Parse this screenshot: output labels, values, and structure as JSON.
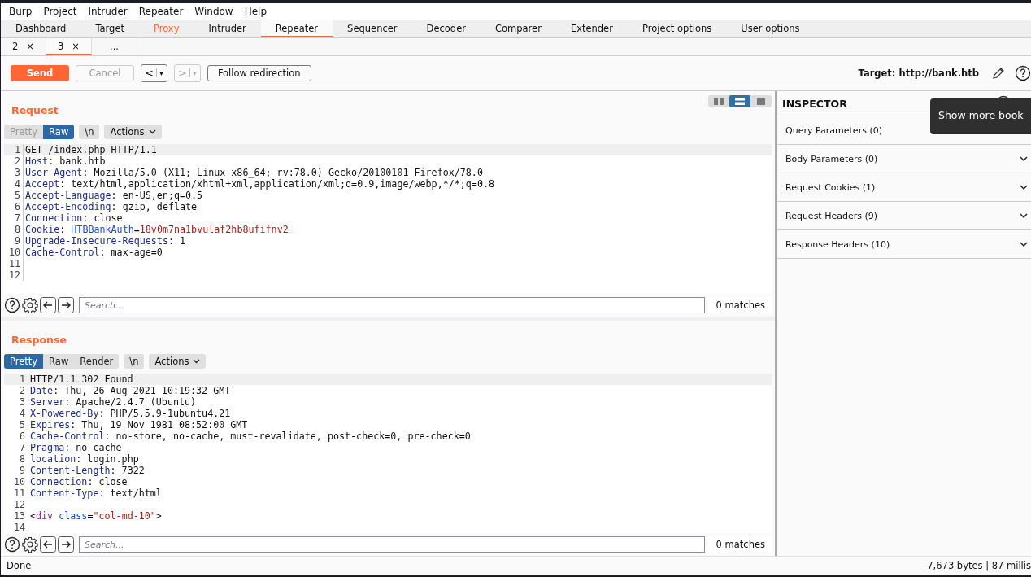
{
  "menu": [
    "Burp",
    "Project",
    "Intruder",
    "Repeater",
    "Window",
    "Help"
  ],
  "tabs": [
    {
      "label": "Dashboard",
      "selected": false,
      "highlighted": false
    },
    {
      "label": "Target",
      "selected": false,
      "highlighted": false
    },
    {
      "label": "Proxy",
      "selected": false,
      "highlighted": true
    },
    {
      "label": "Intruder",
      "selected": false,
      "highlighted": false
    },
    {
      "label": "Repeater",
      "selected": true,
      "highlighted": false
    },
    {
      "label": "Sequencer",
      "selected": false,
      "highlighted": false
    },
    {
      "label": "Decoder",
      "selected": false,
      "highlighted": false
    },
    {
      "label": "Comparer",
      "selected": false,
      "highlighted": false
    },
    {
      "label": "Extender",
      "selected": false,
      "highlighted": false
    },
    {
      "label": "Project options",
      "selected": false,
      "highlighted": false
    },
    {
      "label": "User options",
      "selected": false,
      "highlighted": false
    }
  ],
  "subtabs": [
    {
      "label": "2",
      "close": "×",
      "selected": false
    },
    {
      "label": "3",
      "close": "×",
      "selected": true
    },
    {
      "label": "...",
      "selected": false
    }
  ],
  "toolbar": {
    "send": "Send",
    "cancel": "Cancel",
    "cancel_disabled": true,
    "back": {
      "arrow": "<",
      "caret": "▾",
      "disabled": false
    },
    "forward": {
      "arrow": ">",
      "caret": "▾",
      "disabled": true
    },
    "follow": "Follow redirection",
    "target": "Target: http://bank.htb"
  },
  "layout_buttons": [
    {
      "kind": "columns",
      "selected": false
    },
    {
      "kind": "rows",
      "selected": true
    },
    {
      "kind": "single",
      "selected": false
    }
  ],
  "request": {
    "title": "Request",
    "views": [
      {
        "label": "Pretty",
        "selected": false,
        "disabled": true
      },
      {
        "label": "Raw",
        "selected": true,
        "disabled": false
      }
    ],
    "newline": "\\n",
    "actions": "Actions",
    "lines": [
      {
        "number": "1",
        "current": true,
        "segments": [
          {
            "kind": "plain",
            "text": "GET /index.php HTTP/1.1"
          }
        ]
      },
      {
        "number": "2",
        "current": false,
        "segments": [
          {
            "kind": "key",
            "text": "Host"
          },
          {
            "kind": "plain",
            "text": ": bank.htb"
          }
        ]
      },
      {
        "number": "3",
        "current": false,
        "segments": [
          {
            "kind": "key",
            "text": "User-Agent"
          },
          {
            "kind": "plain",
            "text": ": Mozilla/5.0 (X11; Linux x86_64; rv:78.0) Gecko/20100101 Firefox/78.0"
          }
        ]
      },
      {
        "number": "4",
        "current": false,
        "segments": [
          {
            "kind": "key",
            "text": "Accept"
          },
          {
            "kind": "plain",
            "text": ": text/html,application/xhtml+xml,application/xml;q=0.9,image/webp,*/*;q=0.8"
          }
        ]
      },
      {
        "number": "5",
        "current": false,
        "segments": [
          {
            "kind": "key",
            "text": "Accept-Language"
          },
          {
            "kind": "plain",
            "text": ": en-US,en;q=0.5"
          }
        ]
      },
      {
        "number": "6",
        "current": false,
        "segments": [
          {
            "kind": "key",
            "text": "Accept-Encoding"
          },
          {
            "kind": "plain",
            "text": ": gzip, deflate"
          }
        ]
      },
      {
        "number": "7",
        "current": false,
        "segments": [
          {
            "kind": "key",
            "text": "Connection"
          },
          {
            "kind": "plain",
            "text": ": close"
          }
        ]
      },
      {
        "number": "8",
        "current": false,
        "segments": [
          {
            "kind": "key",
            "text": "Cookie"
          },
          {
            "kind": "plain",
            "text": ": "
          },
          {
            "kind": "cookie_name",
            "text": "HTBBankAuth"
          },
          {
            "kind": "plain",
            "text": "="
          },
          {
            "kind": "cookie_value",
            "text": "18v0m7na1bvulaf2hb8ufifnv2"
          }
        ]
      },
      {
        "number": "9",
        "current": false,
        "segments": [
          {
            "kind": "key",
            "text": "Upgrade-Insecure-Requests"
          },
          {
            "kind": "plain",
            "text": ": 1"
          }
        ]
      },
      {
        "number": "10",
        "current": false,
        "segments": [
          {
            "kind": "key",
            "text": "Cache-Control"
          },
          {
            "kind": "plain",
            "text": ": max-age=0"
          }
        ]
      },
      {
        "number": "11",
        "current": false
      },
      {
        "number": "12",
        "current": false
      }
    ],
    "search": {
      "placeholder": "Search...",
      "matches": "0 matches"
    }
  },
  "response": {
    "title": "Response",
    "views": [
      {
        "label": "Pretty",
        "selected": true,
        "disabled": false
      },
      {
        "label": "Raw",
        "selected": false,
        "disabled": false
      },
      {
        "label": "Render",
        "selected": false,
        "disabled": false
      }
    ],
    "newline": "\\n",
    "actions": "Actions",
    "lines": [
      {
        "number": "1",
        "current": true,
        "segments": [
          {
            "kind": "plain",
            "text": "HTTP/1.1 302 Found"
          }
        ]
      },
      {
        "number": "2",
        "current": false,
        "segments": [
          {
            "kind": "key",
            "text": "Date"
          },
          {
            "kind": "plain",
            "text": ": Thu, 26 Aug 2021 10:19:32 GMT"
          }
        ]
      },
      {
        "number": "3",
        "current": false,
        "segments": [
          {
            "kind": "key",
            "text": "Server"
          },
          {
            "kind": "plain",
            "text": ": Apache/2.4.7 (Ubuntu)"
          }
        ]
      },
      {
        "number": "4",
        "current": false,
        "segments": [
          {
            "kind": "key",
            "text": "X-Powered-By"
          },
          {
            "kind": "plain",
            "text": ": PHP/5.5.9-1ubuntu4.21"
          }
        ]
      },
      {
        "number": "5",
        "current": false,
        "segments": [
          {
            "kind": "key",
            "text": "Expires"
          },
          {
            "kind": "plain",
            "text": ": Thu, 19 Nov 1981 08:52:00 GMT"
          }
        ]
      },
      {
        "number": "6",
        "current": false,
        "segments": [
          {
            "kind": "key",
            "text": "Cache-Control"
          },
          {
            "kind": "plain",
            "text": ": no-store, no-cache, must-revalidate, post-check=0, pre-check=0"
          }
        ]
      },
      {
        "number": "7",
        "current": false,
        "segments": [
          {
            "kind": "key",
            "text": "Pragma"
          },
          {
            "kind": "plain",
            "text": ": no-cache"
          }
        ]
      },
      {
        "number": "8",
        "current": false,
        "segments": [
          {
            "kind": "key",
            "text": "location"
          },
          {
            "kind": "plain",
            "text": ": login.php"
          }
        ]
      },
      {
        "number": "9",
        "current": false,
        "segments": [
          {
            "kind": "key",
            "text": "Content-Length"
          },
          {
            "kind": "plain",
            "text": ": 7322"
          }
        ]
      },
      {
        "number": "10",
        "current": false,
        "segments": [
          {
            "kind": "key",
            "text": "Connection"
          },
          {
            "kind": "plain",
            "text": ": close"
          }
        ]
      },
      {
        "number": "11",
        "current": false,
        "segments": [
          {
            "kind": "key",
            "text": "Content-Type"
          },
          {
            "kind": "plain",
            "text": ": text/html"
          }
        ]
      },
      {
        "number": "12",
        "current": false
      },
      {
        "number": "13",
        "current": false,
        "segments": [
          {
            "kind": "plain",
            "text": "<"
          },
          {
            "kind": "tag",
            "text": "div"
          },
          {
            "kind": "attr",
            "text": " class"
          },
          {
            "kind": "plain",
            "text": "="
          },
          {
            "kind": "string",
            "text": "\"col-md-10\""
          },
          {
            "kind": "plain",
            "text": ">"
          }
        ]
      },
      {
        "number": "14",
        "current": false
      }
    ],
    "search": {
      "placeholder": "Search...",
      "matches": "0 matches"
    }
  },
  "inspector": {
    "title": "INSPECTOR",
    "tooltip": "Show more book",
    "sections": [
      {
        "label": "Query Parameters (0)",
        "expanded": false
      },
      {
        "label": "Body Parameters (0)",
        "expanded": false
      },
      {
        "label": "Request Cookies (1)",
        "expanded": false
      },
      {
        "label": "Request Headers (9)",
        "expanded": false
      },
      {
        "label": "Response Headers (10)",
        "expanded": false
      }
    ]
  },
  "status_bar": {
    "left": "Done",
    "right": "7,673 bytes | 87 millis"
  }
}
